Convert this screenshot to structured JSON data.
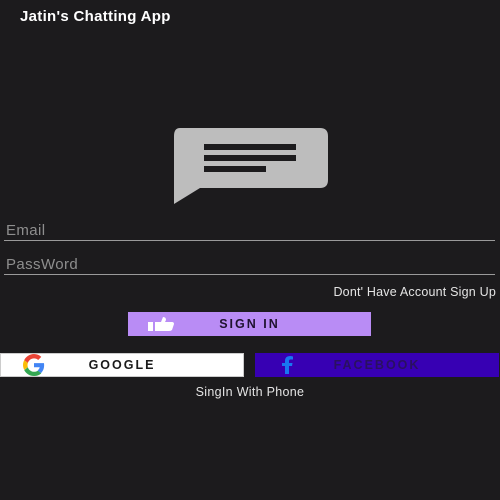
{
  "app": {
    "title": "Jatin's Chatting App"
  },
  "logo": {
    "icon": "chat-message-icon",
    "color": "#bdbdbd"
  },
  "form": {
    "email_placeholder": "Email",
    "email_value": "",
    "password_placeholder": "PassWord",
    "password_value": ""
  },
  "signup_link": "Dont' Have Account Sign Up",
  "buttons": {
    "signin": {
      "label": "SIGN IN",
      "icon": "thumbs-up-icon",
      "color": "#b98cf5"
    },
    "google": {
      "label": "GOOGLE",
      "icon": "google-icon",
      "color": "#ffffff"
    },
    "facebook": {
      "label": "FACEBOOK",
      "icon": "facebook-icon",
      "color": "#3700b3"
    }
  },
  "phone_link": "SingIn With Phone",
  "colors": {
    "background": "#1c1b1d",
    "accent": "#b98cf5"
  }
}
